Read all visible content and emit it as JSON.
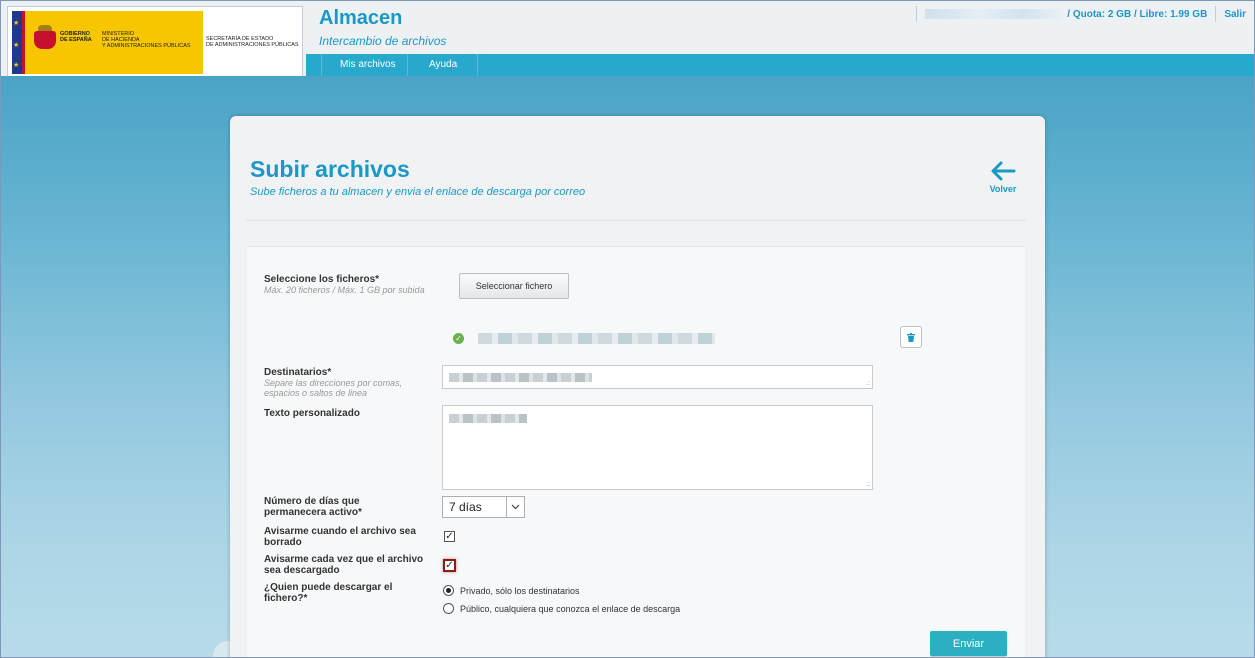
{
  "header": {
    "logo": {
      "gov_text": "GOBIERNO\nDE ESPAÑA",
      "ministry_text": "MINISTERIO\nDE HACIENDA\nY ADMINISTRACIONES PÚBLICAS",
      "secretary_text": "SECRETARÍA DE ESTADO\nDE ADMINISTRACIONES PÚBLICAS"
    },
    "app_title": "Almacen",
    "app_subtitle": "Intercambio de archivos",
    "quota": "/ Quota: 2 GB / Libre: 1.99 GB",
    "logout": "Salir",
    "nav": [
      {
        "label": "Mis archivos"
      },
      {
        "label": "Ayuda"
      }
    ]
  },
  "page": {
    "title": "Subir archivos",
    "subtitle": "Sube ficheros a tu almacen y envia el enlace de descarga por correo",
    "back_label": "Volver"
  },
  "form": {
    "files": {
      "label": "Seleccione los ficheros*",
      "hint": "Máx. 20 ficheros / Máx. 1 GB por subida",
      "button": "Seleccionar fichero"
    },
    "recipients": {
      "label": "Destinatarios*",
      "hint": "Separe las direcciones por comas, espacios o saltos de linea"
    },
    "custom_text": {
      "label": "Texto personalizado"
    },
    "days": {
      "label": "Número de días que permanecera activo*",
      "value": "7 días"
    },
    "notify_deleted": {
      "label": "Avisarme cuando el archivo sea borrado",
      "checked": true
    },
    "notify_downloaded": {
      "label": "Avisarme cada vez que el archivo sea descargado",
      "checked": true
    },
    "access": {
      "label": "¿Quien puede descargar el fichero?*",
      "options": [
        {
          "label": "Privado, sólo los destinatarios",
          "selected": true
        },
        {
          "label": "Público, cualquiera que conozca el enlace de descarga",
          "selected": false
        }
      ]
    },
    "submit": "Enviar"
  },
  "colors": {
    "accent": "#1a99c6",
    "nav_bar": "#29a8cd",
    "send_button": "#2ab0c0"
  }
}
